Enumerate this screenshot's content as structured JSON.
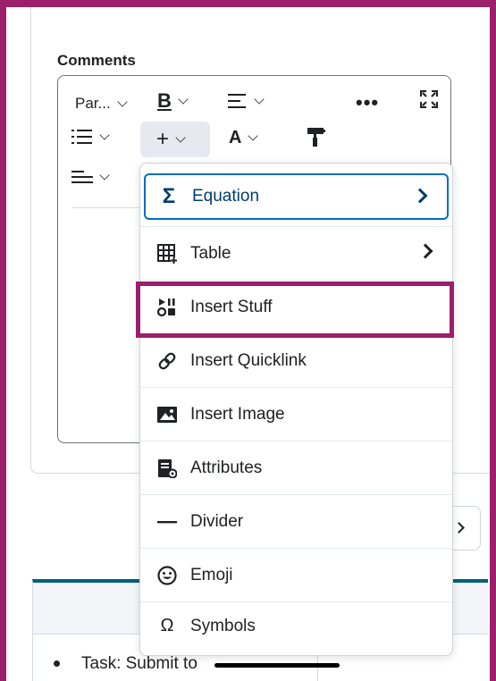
{
  "section": {
    "label": "Comments"
  },
  "toolbar": {
    "paragraph_label": "Par...",
    "bold_label": "B",
    "align_glyph": "☰",
    "more_glyph": "•••",
    "insert_glyph": "+",
    "format_glyph": "A"
  },
  "insert_menu": {
    "items": [
      {
        "label": "Equation",
        "icon": "sigma-icon",
        "glyph": "Σ",
        "has_submenu": true,
        "selected": true
      },
      {
        "label": "Table",
        "icon": "table-icon",
        "glyph": "▦",
        "has_submenu": true
      },
      {
        "label": "Insert Stuff",
        "icon": "insert-stuff-icon",
        "glyph": "▶",
        "has_submenu": false
      },
      {
        "label": "Insert Quicklink",
        "icon": "link-icon",
        "glyph": "🔗",
        "has_submenu": false
      },
      {
        "label": "Insert Image",
        "icon": "image-icon",
        "glyph": "▣",
        "has_submenu": false
      },
      {
        "label": "Attributes",
        "icon": "attributes-icon",
        "glyph": "▤",
        "has_submenu": false
      },
      {
        "label": "Divider",
        "icon": "divider-icon",
        "glyph": "—",
        "has_submenu": false
      },
      {
        "label": "Emoji",
        "icon": "emoji-icon",
        "glyph": "☺",
        "has_submenu": false
      },
      {
        "label": "Symbols",
        "icon": "omega-icon",
        "glyph": "Ω",
        "has_submenu": false
      }
    ]
  },
  "content": {
    "task_text": "Task: Submit to"
  },
  "colors": {
    "accent": "#006fbf",
    "highlight": "#9c1f6b",
    "teal": "#006079"
  }
}
